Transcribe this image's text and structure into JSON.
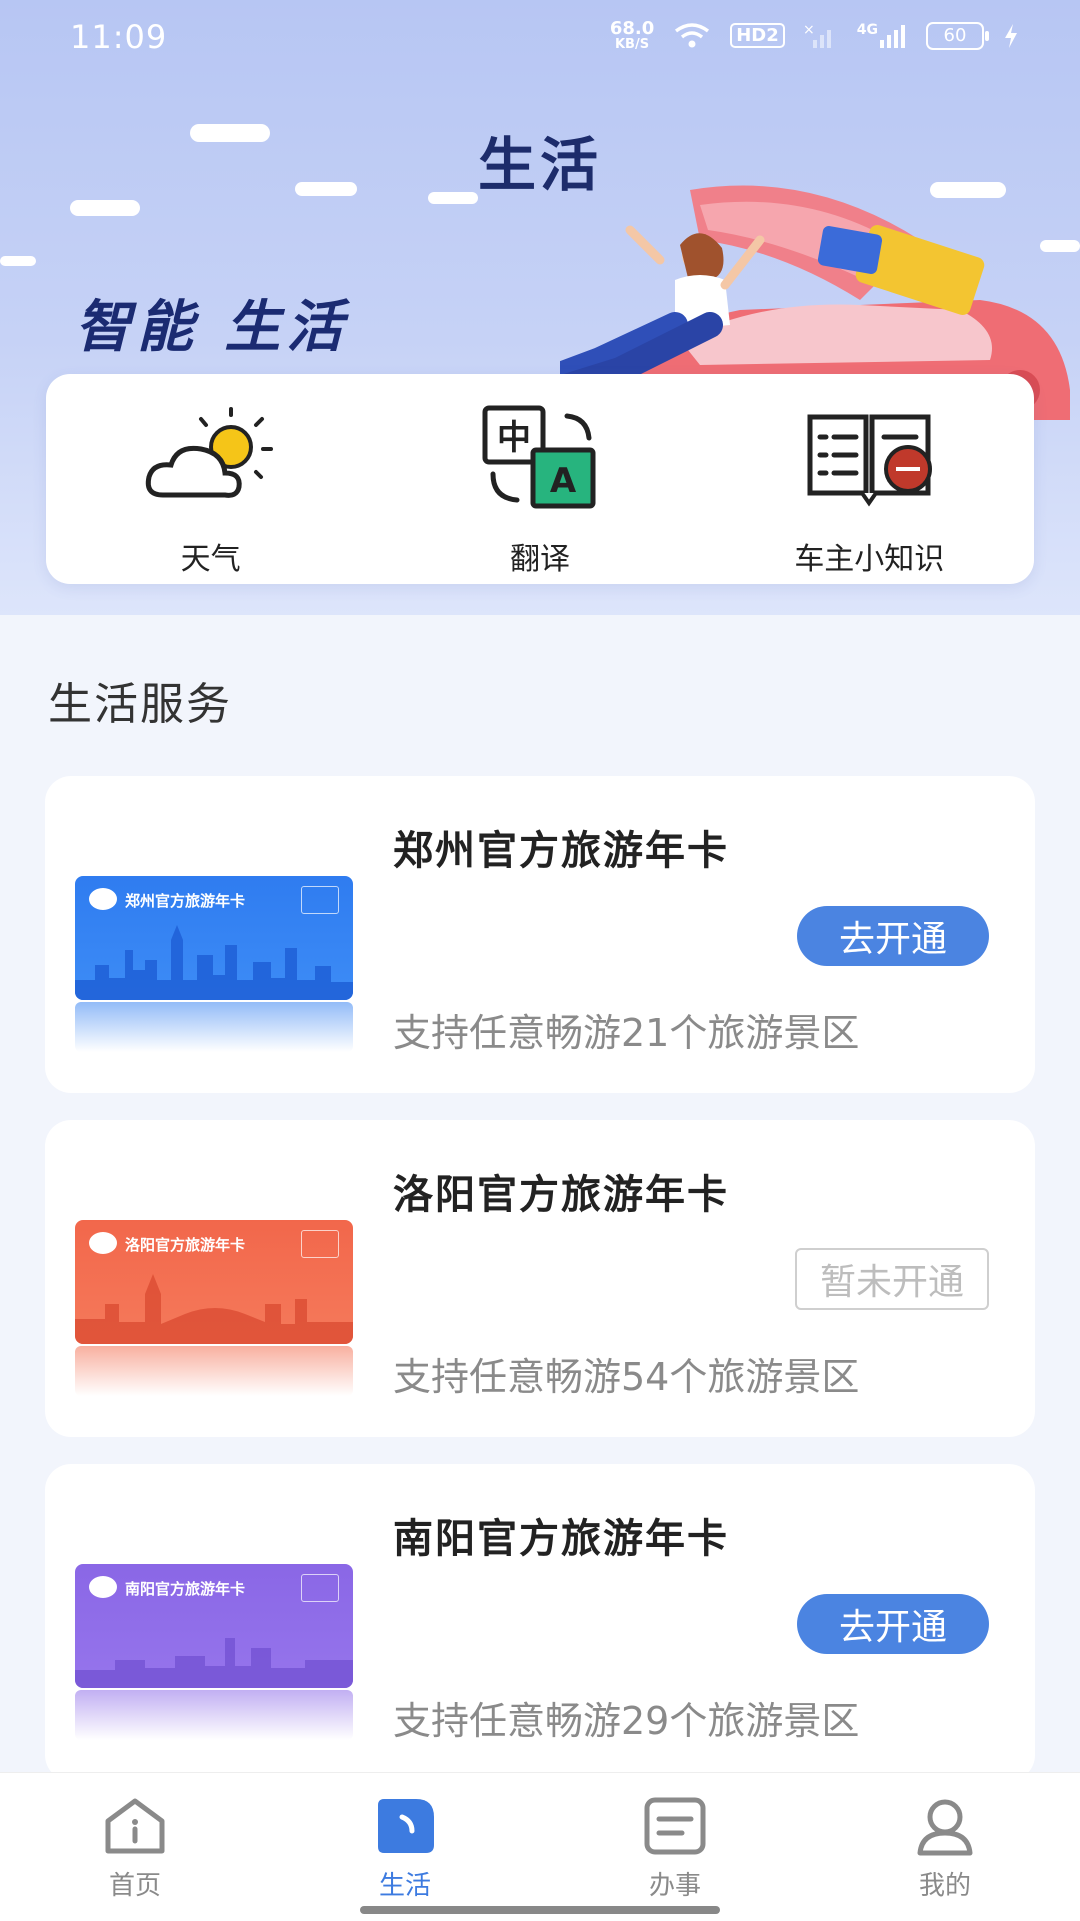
{
  "status_bar": {
    "time": "11:09",
    "speed_value": "68.0",
    "speed_unit": "KB/S",
    "hd": "HD2",
    "network": "4G",
    "battery": "60"
  },
  "header": {
    "title": "生活",
    "slogan": "智能 生活"
  },
  "tools": [
    {
      "label": "天气",
      "icon": "weather-icon"
    },
    {
      "label": "翻译",
      "icon": "translate-icon"
    },
    {
      "label": "车主小知识",
      "icon": "book-icon"
    }
  ],
  "section": {
    "title": "生活服务"
  },
  "cards": [
    {
      "title": "郑州官方旅游年卡",
      "image_title": "郑州官方旅游年卡",
      "button": "去开通",
      "enabled": true,
      "desc": "支持任意畅游21个旅游景区",
      "color": "#3b7ff0"
    },
    {
      "title": "洛阳官方旅游年卡",
      "image_title": "洛阳官方旅游年卡",
      "button": "暂未开通",
      "enabled": false,
      "desc": "支持任意畅游54个旅游景区",
      "color": "#f2674b"
    },
    {
      "title": "南阳官方旅游年卡",
      "image_title": "南阳官方旅游年卡",
      "button": "去开通",
      "enabled": true,
      "desc": "支持任意畅游29个旅游景区",
      "color": "#8f6ee8"
    }
  ],
  "bottom_nav": [
    {
      "label": "首页",
      "icon": "home-icon",
      "active": false
    },
    {
      "label": "生活",
      "icon": "life-icon",
      "active": true
    },
    {
      "label": "办事",
      "icon": "tasks-icon",
      "active": false
    },
    {
      "label": "我的",
      "icon": "profile-icon",
      "active": false
    }
  ],
  "colors": {
    "accent": "#4b84e1",
    "active_nav": "#3d7be0",
    "hero_title": "#1d2c6b"
  }
}
